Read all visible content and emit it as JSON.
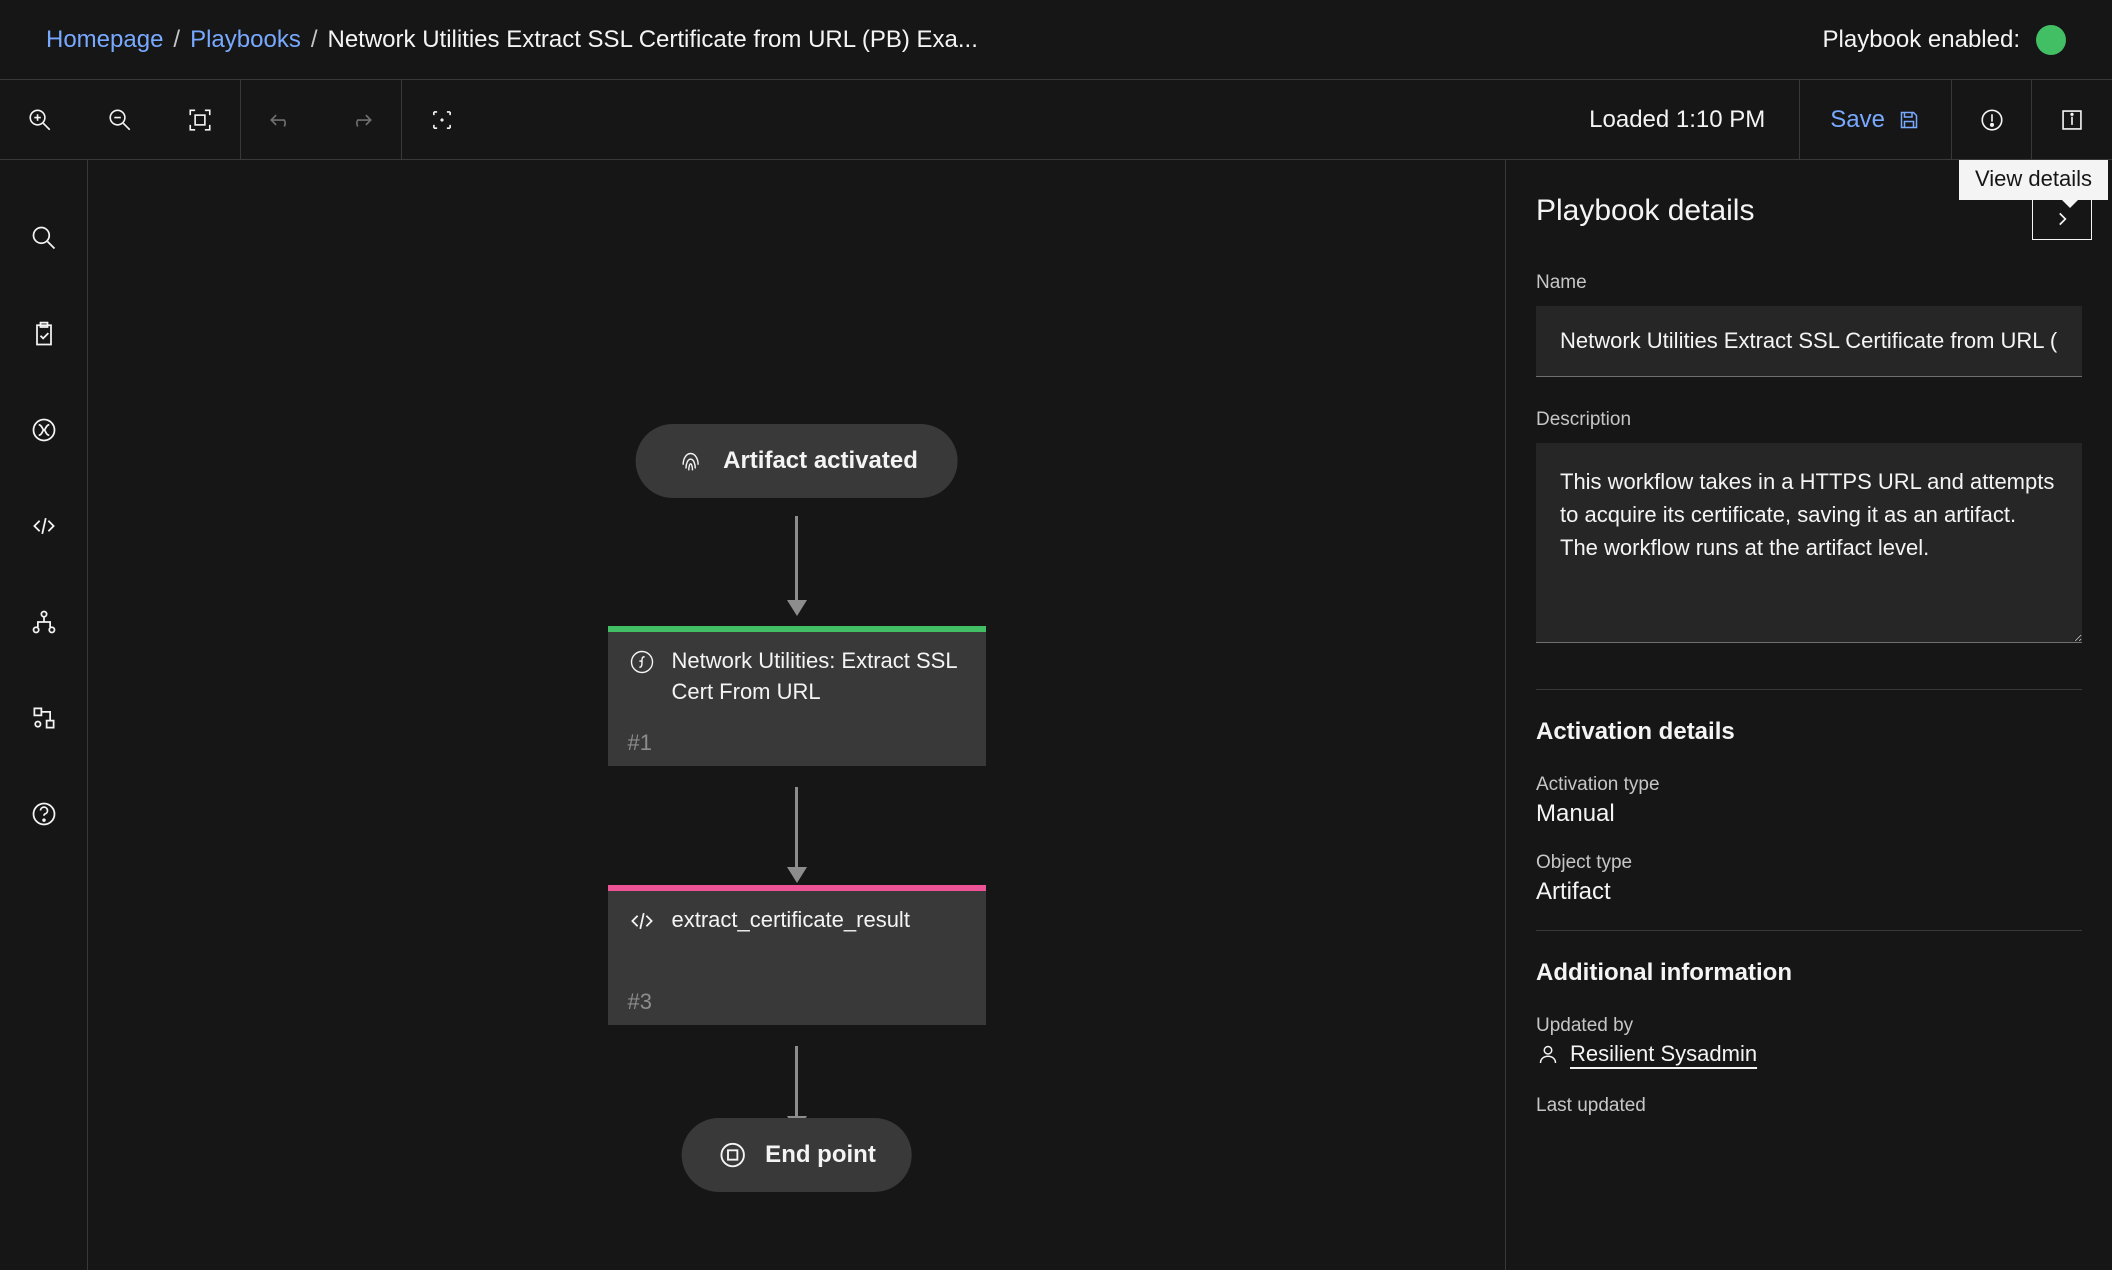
{
  "breadcrumb": {
    "home": "Homepage",
    "playbooks": "Playbooks",
    "current": "Network Utilities Extract SSL Certificate from URL (PB) Exa...",
    "enabled_label": "Playbook enabled:"
  },
  "toolbar": {
    "loaded": "Loaded 1:10 PM",
    "save": "Save",
    "tooltip": "View details"
  },
  "canvas": {
    "start_label": "Artifact activated",
    "node1": {
      "title": "Network Utilities: Extract SSL Cert From URL",
      "num": "#1"
    },
    "node2": {
      "title": "extract_certificate_result",
      "num": "#3"
    },
    "end_label": "End point"
  },
  "details": {
    "heading": "Playbook details",
    "name_label": "Name",
    "name_value": "Network Utilities Extract SSL Certificate from URL (PB) Example",
    "desc_label": "Description",
    "desc_value": "This workflow takes in a HTTPS URL and attempts to acquire its certificate, saving it as an artifact.\nThe workflow runs at the artifact level.",
    "activation_heading": "Activation details",
    "activation_type_label": "Activation type",
    "activation_type_value": "Manual",
    "object_type_label": "Object type",
    "object_type_value": "Artifact",
    "additional_heading": "Additional information",
    "updated_by_label": "Updated by",
    "updated_by_value": "Resilient Sysadmin",
    "last_updated_label": "Last updated"
  }
}
